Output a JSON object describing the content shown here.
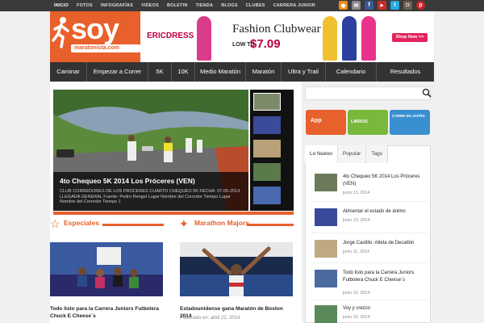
{
  "topnav": [
    "INICIO",
    "FOTOS",
    "INFOGRAFÍAS",
    "VIDEOS",
    "BOLETIN",
    "TIENDA",
    "BLOGS",
    "CLUBES",
    "CARRERA JUNIOR"
  ],
  "social_icons": [
    "rss-icon",
    "mail-icon",
    "facebook-icon",
    "youtube-icon",
    "twitter-icon",
    "instagram-icon",
    "pinterest-icon"
  ],
  "logo": {
    "main": "soy",
    "sub": "maratonista.com"
  },
  "ad": {
    "brand": "ERICDRESS",
    "title": "Fashion Clubwear",
    "low_to": "LOW TO",
    "price": "$7.09",
    "shop": "Shop Now >>"
  },
  "mainnav": [
    "Caminar",
    "Empezar a Correr",
    "5K",
    "10K",
    "Medio Maratón",
    "Maratón",
    "Ultra y Trail",
    "Calendario",
    "Resultados"
  ],
  "slider": {
    "title": "4to Chequeo 5K 2014 Los Próceres (VEN)",
    "text": "CLUB CORREDORES DE LOS PROCERES CUARTO CHEQUEO 5K FECHA: 07-06-2014 LLEGADA GENERAL Fuente: Pedro Rengel Lugar Nombre del Corredor Tiempo Lugar Nombre del Corredor Tiempo 1"
  },
  "sections": {
    "left": "Especiales",
    "right": "Marathon Majors"
  },
  "cards": [
    {
      "title": "Todo listo para la Carrera Juniors Futbolera Chuck E Cheese´s",
      "date": ""
    },
    {
      "title": "Estadounidense gana Maratón de Boston 2014",
      "date": "Publicado en: abril 22, 2014"
    }
  ],
  "banners": [
    {
      "label": "App",
      "color": "#e8602c"
    },
    {
      "label": "LIBROS",
      "color": "#79b83a"
    },
    {
      "label": "CORRE EN JAPÓN",
      "color": "#3a8fd0"
    }
  ],
  "tabs": [
    "Lo Nuevo",
    "Popular",
    "Tags"
  ],
  "sidebar_list": [
    {
      "title": "4to Chequeo 5K 2014 Los Próceres (VEN)",
      "date": "junio 13, 2014"
    },
    {
      "title": "Alimentar el estado de ánimo",
      "date": "junio 13, 2014"
    },
    {
      "title": "Jorge Castillo: Atleta de Decatlón",
      "date": "junio 11, 2014"
    },
    {
      "title": "Todo listo para la Carrera Juniors Futbolera Chuck E Cheese´s",
      "date": "junio 10, 2014"
    },
    {
      "title": "Voy y crezco",
      "date": "junio 10, 2014"
    }
  ],
  "colors": {
    "accent": "#e8602c",
    "nav": "#333333",
    "topbar": "#3a3a3a"
  }
}
